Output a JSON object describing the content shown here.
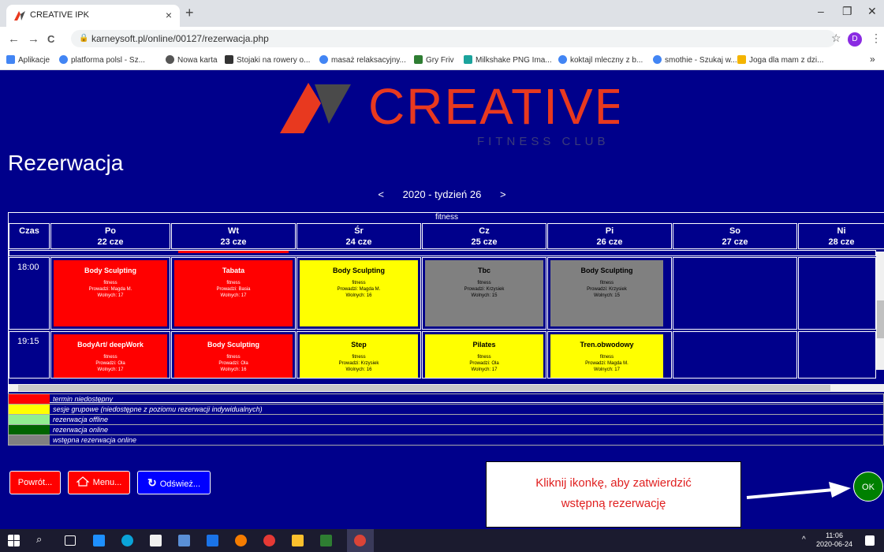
{
  "browser": {
    "tab_title": "CREATIVE IPK",
    "tab_close": "×",
    "new_tab": "+",
    "win_min": "–",
    "win_max": "❐",
    "win_close": "✕",
    "back": "←",
    "forward": "→",
    "reload": "C",
    "url": "karneysoft.pl/online/00127/rezerwacja.php",
    "star": "☆",
    "avatar": "D",
    "menu": "⋮",
    "bookmarks": [
      "Aplikacje",
      "platforma polsl - Sz...",
      "Nowa karta",
      "Stojaki na rowery o...",
      "masaż relaksacyjny...",
      "Gry Friv",
      "Milkshake PNG Ima...",
      "koktajl mleczny z b...",
      "smothie - Szukaj w...",
      "Joga dla mam z dzi..."
    ],
    "bookmarks_more": "»"
  },
  "logo": {
    "name": "CREATIVE",
    "subtitle": "FITNESS CLUB",
    "colors": {
      "red": "#e8391f",
      "dark": "#4a4a4a"
    }
  },
  "page": {
    "title": "Rezerwacja",
    "week_prev": "<",
    "week_label": "2020 - tydzień 26",
    "week_next": ">"
  },
  "schedule": {
    "section": "fitness",
    "time_header": "Czas",
    "days": [
      {
        "name": "Po",
        "date": "22 cze"
      },
      {
        "name": "Wt",
        "date": "23 cze"
      },
      {
        "name": "Śr",
        "date": "24 cze"
      },
      {
        "name": "Cz",
        "date": "25 cze"
      },
      {
        "name": "Pi",
        "date": "26 cze"
      },
      {
        "name": "So",
        "date": "27 cze"
      },
      {
        "name": "Ni",
        "date": "28 cze"
      }
    ],
    "rows": [
      {
        "time": "18:00",
        "classes": [
          {
            "name": "Body Sculpting",
            "type": "fitness",
            "trainer": "Prowadzi: Magda M.",
            "free": "Wolnych: 17",
            "color": "red"
          },
          {
            "name": "Tabata",
            "type": "fitness",
            "trainer": "Prowadzi: Basia",
            "free": "Wolnych: 17",
            "color": "red"
          },
          {
            "name": "Body Sculpting",
            "type": "fitness",
            "trainer": "Prowadzi: Magda M.",
            "free": "Wolnych: 16",
            "color": "yellow"
          },
          {
            "name": "Tbc",
            "type": "fitness",
            "trainer": "Prowadzi: Krzysiek",
            "free": "Wolnych: 15",
            "color": "grey"
          },
          {
            "name": "Body Sculpting",
            "type": "fitness",
            "trainer": "Prowadzi: Krzysiek",
            "free": "Wolnych: 15",
            "color": "grey"
          }
        ]
      },
      {
        "time": "19:15",
        "classes": [
          {
            "name": "BodyArt/ deepWork",
            "type": "fitness",
            "trainer": "Prowadzi: Ola",
            "free": "Wolnych: 17",
            "color": "red"
          },
          {
            "name": "Body Sculpting",
            "type": "fitness",
            "trainer": "Prowadzi: Ola",
            "free": "Wolnych: 16",
            "color": "red"
          },
          {
            "name": "Step",
            "type": "fitness",
            "trainer": "Prowadzi: Krzysiek",
            "free": "Wolnych: 16",
            "color": "yellow"
          },
          {
            "name": "Pilates",
            "type": "fitness",
            "trainer": "Prowadzi: Ola",
            "free": "Wolnych: 17",
            "color": "yellow"
          },
          {
            "name": "Tren.obwodowy",
            "type": "fitness",
            "trainer": "Prowadzi: Magda M.",
            "free": "Wolnych: 17",
            "color": "yellow"
          }
        ]
      }
    ]
  },
  "legend": [
    {
      "color": "#ff0000",
      "label": "termin niedostępny"
    },
    {
      "color": "#ffff00",
      "label": "sesje grupowe (niedostępne z poziomu rezerwacji indywidualnych)"
    },
    {
      "color": "#90ee90",
      "label": "rezerwacja offline"
    },
    {
      "color": "#006400",
      "label": "rezerwacja online"
    },
    {
      "color": "#808080",
      "label": "wstępna rezerwacja online"
    }
  ],
  "buttons": {
    "back": "Powrót...",
    "menu": "Menu...",
    "refresh": "Odśwież...",
    "ok": "OK"
  },
  "callout": {
    "line1": "Kliknij ikonkę, aby zatwierdzić",
    "line2": "wstępną rezerwację"
  },
  "taskbar": {
    "time": "11:06",
    "date": "2020-06-24",
    "tray": "^"
  }
}
